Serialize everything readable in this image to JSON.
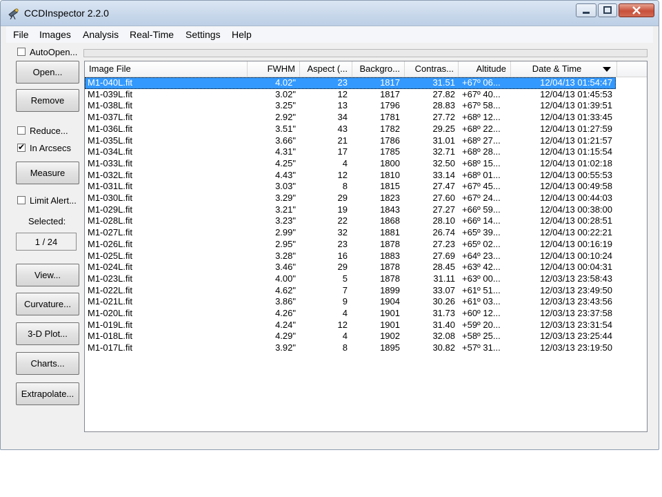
{
  "window": {
    "title": "CCDInspector 2.2.0"
  },
  "menu": [
    "File",
    "Images",
    "Analysis",
    "Real-Time",
    "Settings",
    "Help"
  ],
  "left_panel": {
    "autoopen_label": "AutoOpen...",
    "autoopen_checked": false,
    "open_button": "Open...",
    "remove_button": "Remove",
    "reduce_label": "Reduce...",
    "reduce_checked": false,
    "arcsecs_label": "In Arcsecs",
    "arcsecs_checked": true,
    "measure_button": "Measure",
    "limit_alert_label": "Limit Alert...",
    "limit_alert_checked": false,
    "selected_label": "Selected:",
    "selected_value": "1 / 24",
    "view_button": "View...",
    "curvature_button": "Curvature...",
    "plot3d_button": "3-D Plot...",
    "charts_button": "Charts...",
    "extrapolate_button": "Extrapolate..."
  },
  "table": {
    "columns": [
      "Image File",
      "FWHM",
      "Aspect (...",
      "Backgro...",
      "Contras...",
      "Altitude",
      "Date & Time"
    ],
    "selected_row": 0,
    "rows": [
      [
        "M1-040L.fit",
        "4.02\"",
        "23",
        "1817",
        "31.51",
        "+67º 06...",
        "12/04/13 01:54:47"
      ],
      [
        "M1-039L.fit",
        "3.02\"",
        "12",
        "1817",
        "27.82",
        "+67º 40...",
        "12/04/13 01:45:53"
      ],
      [
        "M1-038L.fit",
        "3.25\"",
        "13",
        "1796",
        "28.83",
        "+67º 58...",
        "12/04/13 01:39:51"
      ],
      [
        "M1-037L.fit",
        "2.92\"",
        "34",
        "1781",
        "27.72",
        "+68º 12...",
        "12/04/13 01:33:45"
      ],
      [
        "M1-036L.fit",
        "3.51\"",
        "43",
        "1782",
        "29.25",
        "+68º 22...",
        "12/04/13 01:27:59"
      ],
      [
        "M1-035L.fit",
        "3.66\"",
        "21",
        "1786",
        "31.01",
        "+68º 27...",
        "12/04/13 01:21:57"
      ],
      [
        "M1-034L.fit",
        "4.31\"",
        "17",
        "1785",
        "32.71",
        "+68º 28...",
        "12/04/13 01:15:54"
      ],
      [
        "M1-033L.fit",
        "4.25\"",
        "4",
        "1800",
        "32.50",
        "+68º 15...",
        "12/04/13 01:02:18"
      ],
      [
        "M1-032L.fit",
        "4.43\"",
        "12",
        "1810",
        "33.14",
        "+68º 01...",
        "12/04/13 00:55:53"
      ],
      [
        "M1-031L.fit",
        "3.03\"",
        "8",
        "1815",
        "27.47",
        "+67º 45...",
        "12/04/13 00:49:58"
      ],
      [
        "M1-030L.fit",
        "3.29\"",
        "29",
        "1823",
        "27.60",
        "+67º 24...",
        "12/04/13 00:44:03"
      ],
      [
        "M1-029L.fit",
        "3.21\"",
        "19",
        "1843",
        "27.27",
        "+66º 59...",
        "12/04/13 00:38:00"
      ],
      [
        "M1-028L.fit",
        "3.23\"",
        "22",
        "1868",
        "28.10",
        "+66º 14...",
        "12/04/13 00:28:51"
      ],
      [
        "M1-027L.fit",
        "2.99\"",
        "32",
        "1881",
        "26.74",
        "+65º 39...",
        "12/04/13 00:22:21"
      ],
      [
        "M1-026L.fit",
        "2.95\"",
        "23",
        "1878",
        "27.23",
        "+65º 02...",
        "12/04/13 00:16:19"
      ],
      [
        "M1-025L.fit",
        "3.28\"",
        "16",
        "1883",
        "27.69",
        "+64º 23...",
        "12/04/13 00:10:24"
      ],
      [
        "M1-024L.fit",
        "3.46\"",
        "29",
        "1878",
        "28.45",
        "+63º 42...",
        "12/04/13 00:04:31"
      ],
      [
        "M1-023L.fit",
        "4.00\"",
        "5",
        "1878",
        "31.11",
        "+63º 00...",
        "12/03/13 23:58:43"
      ],
      [
        "M1-022L.fit",
        "4.62\"",
        "7",
        "1899",
        "33.07",
        "+61º 51...",
        "12/03/13 23:49:50"
      ],
      [
        "M1-021L.fit",
        "3.86\"",
        "9",
        "1904",
        "30.26",
        "+61º 03...",
        "12/03/13 23:43:56"
      ],
      [
        "M1-020L.fit",
        "4.26\"",
        "4",
        "1901",
        "31.73",
        "+60º 12...",
        "12/03/13 23:37:58"
      ],
      [
        "M1-019L.fit",
        "4.24\"",
        "12",
        "1901",
        "31.40",
        "+59º 20...",
        "12/03/13 23:31:54"
      ],
      [
        "M1-018L.fit",
        "4.29\"",
        "4",
        "1902",
        "32.08",
        "+58º 25...",
        "12/03/13 23:25:44"
      ],
      [
        "M1-017L.fit",
        "3.92\"",
        "8",
        "1895",
        "30.82",
        "+57º 31...",
        "12/03/13 23:19:50"
      ]
    ]
  },
  "icons": [
    "telescope-icon",
    "minimize-icon",
    "maximize-icon",
    "close-icon",
    "sort-descending-icon"
  ],
  "colors": {
    "selection": "#3399ff",
    "close_button": "#c7503a"
  }
}
